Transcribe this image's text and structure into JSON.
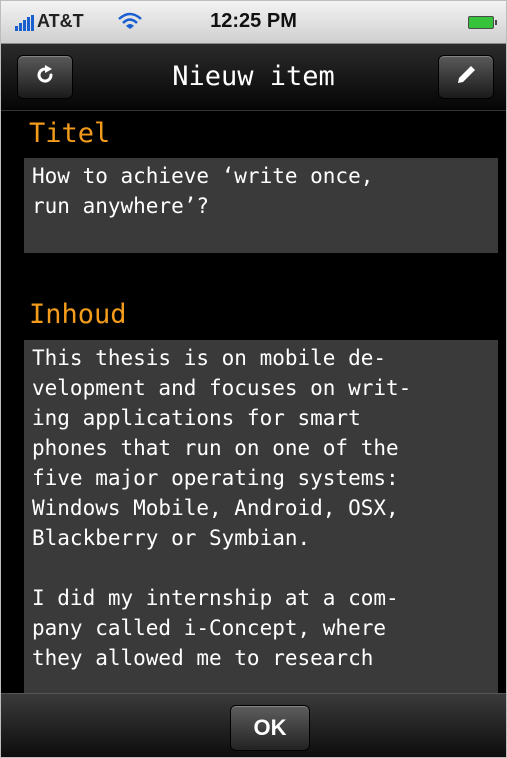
{
  "statusbar": {
    "carrier": "AT&T",
    "time": "12:25 PM",
    "icons": [
      "signal-icon",
      "wifi-icon",
      "battery-icon"
    ],
    "battery_color": "#36c23a"
  },
  "navbar": {
    "title": "Nieuw item",
    "left_button_icon": "refresh-icon",
    "right_button_icon": "edit-pencil-icon"
  },
  "form": {
    "title_label": "Titel",
    "title_value": "How to achieve ‘write once,\nrun anywhere’?",
    "content_label": "Inhoud",
    "content_value": "This thesis is on mobile de-\nvelopment and focuses on writ-\ning applications for smart\nphones that run on one of the\nfive major operating systems:\nWindows Mobile, Android, OSX,\nBlackberry or Symbian.\n\nI did my internship at a com-\npany called i-Concept, where\nthey allowed me to research"
  },
  "toolbar": {
    "ok_label": "OK"
  },
  "colors": {
    "label_orange": "#f39c1c",
    "field_bg": "#3a3a3a",
    "background": "#000000"
  }
}
